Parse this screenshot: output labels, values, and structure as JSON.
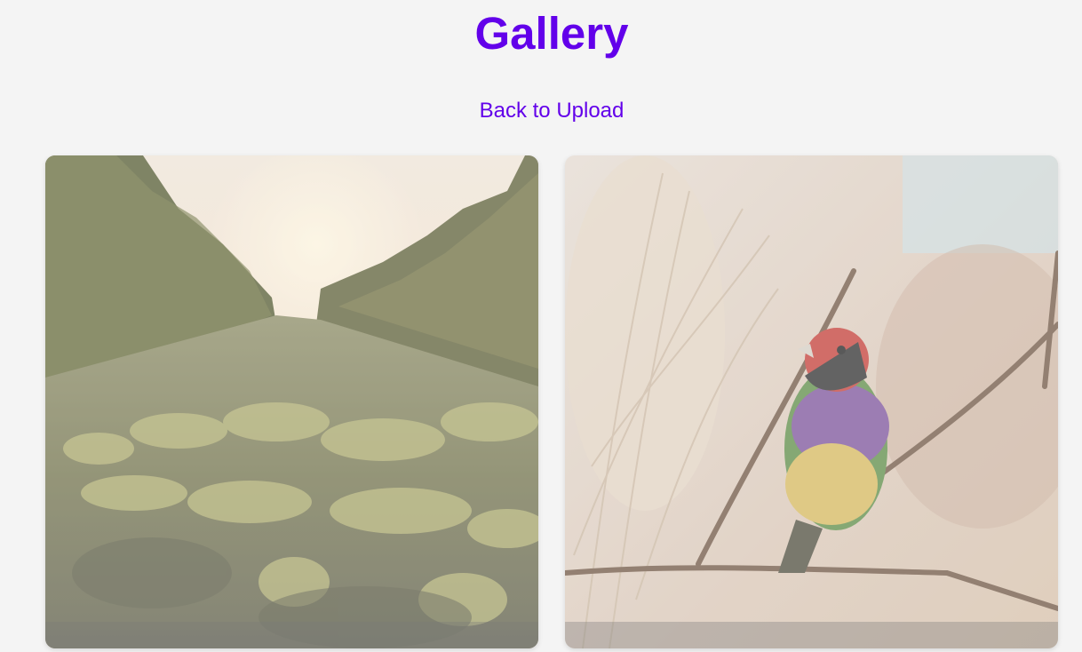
{
  "header": {
    "title": "Gallery",
    "back_link_label": "Back to Upload"
  },
  "gallery": {
    "items": [
      {
        "subject": "vineyard-sunset-photo"
      },
      {
        "subject": "finch-on-branch-photo"
      }
    ]
  },
  "colors": {
    "accent": "#6200ea",
    "background": "#f4f4f4"
  }
}
